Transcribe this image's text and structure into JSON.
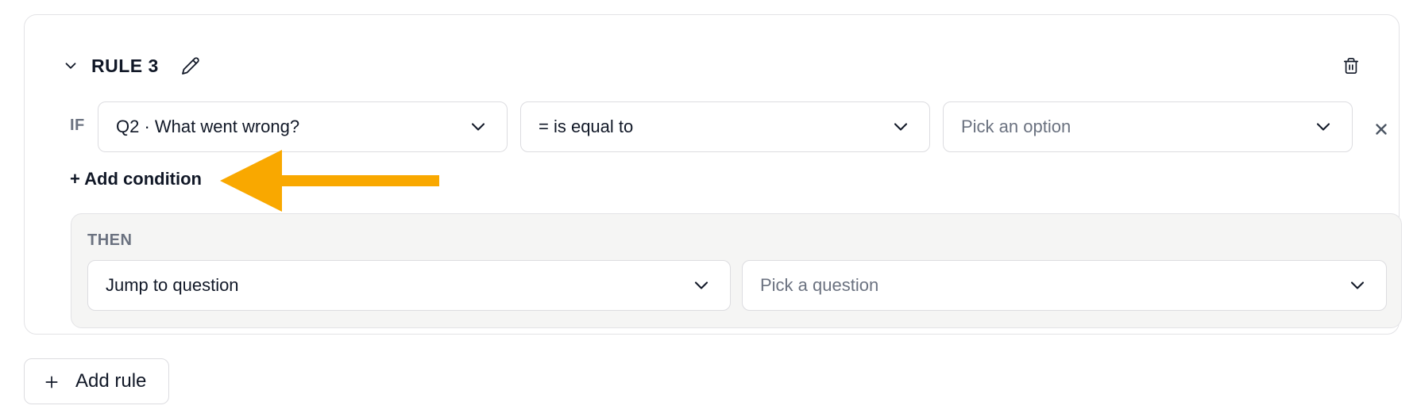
{
  "rule": {
    "title": "RULE 3",
    "if_label": "IF",
    "condition": {
      "question": "Q2 · What went wrong?",
      "operator": "= is equal to",
      "option_placeholder": "Pick an option"
    },
    "add_condition_label": "+ Add condition",
    "then": {
      "label": "THEN",
      "action": "Jump to question",
      "target_placeholder": "Pick a question"
    }
  },
  "add_rule_label": "Add rule",
  "icons": {
    "collapse": "chevron-down-icon",
    "edit": "pencil-icon",
    "delete": "trash-icon",
    "remove_condition": "close-icon",
    "dropdown": "chevron-down-icon",
    "add": "plus-icon",
    "annotation": "arrow-left-icon"
  },
  "colors": {
    "annotation_arrow": "#F9A800",
    "muted_text": "#6b7280",
    "border": "#dcdce0",
    "then_background": "#f5f5f4"
  }
}
